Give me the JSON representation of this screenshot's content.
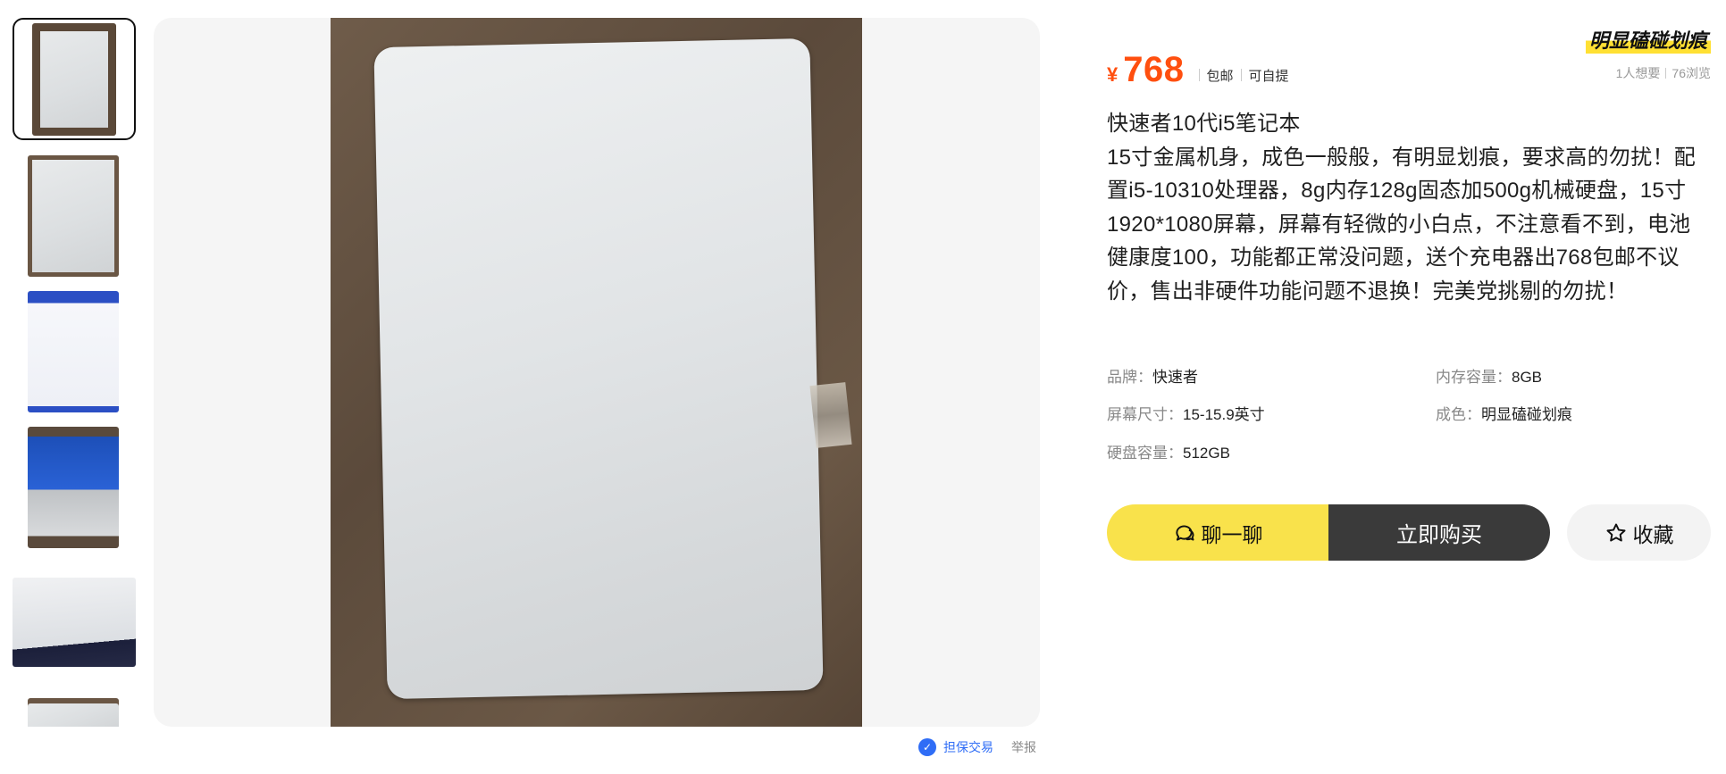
{
  "thumbnails": [
    {
      "name": "thumb-lid-top",
      "selected": true
    },
    {
      "name": "thumb-bottom"
    },
    {
      "name": "thumb-screen-specs"
    },
    {
      "name": "thumb-laptop-open"
    },
    {
      "name": "thumb-screen-closeup"
    },
    {
      "name": "thumb-partial"
    }
  ],
  "trust": {
    "guarantee_label": "担保交易",
    "report_label": "举报"
  },
  "listing": {
    "condition_tag": "明显磕碰划痕",
    "currency": "¥",
    "price": "768",
    "tag_shipping": "包邮",
    "tag_pickup": "可自提",
    "wants": "1人想要",
    "views": "76浏览",
    "description": "快速者10代i5笔记本\n15寸金属机身，成色一般般，有明显划痕，要求高的勿扰！配置i5-10310处理器，8g内存128g固态加500g机械硬盘，15寸1920*1080屏幕，屏幕有轻微的小白点，不注意看不到，电池健康度100，功能都正常没问题，送个充电器出768包邮不议价，售出非硬件功能问题不退换！完美党挑剔的勿扰！"
  },
  "attributes": [
    {
      "key": "品牌：",
      "value": "快速者"
    },
    {
      "key": "内存容量：",
      "value": "8GB"
    },
    {
      "key": "屏幕尺寸：",
      "value": "15-15.9英寸"
    },
    {
      "key": "成色：",
      "value": "明显磕碰划痕"
    },
    {
      "key": "硬盘容量：",
      "value": "512GB"
    }
  ],
  "actions": {
    "chat_label": "聊一聊",
    "buy_label": "立即购买",
    "favorite_label": "收藏"
  },
  "colors": {
    "price": "#ff4f0f",
    "chat_button": "#f9e24b",
    "buy_button": "#3a3a3a",
    "guarantee": "#2f6df6"
  },
  "icons": {
    "chat": "chat-bubble-icon",
    "favorite": "star-icon",
    "guarantee": "shield-icon"
  }
}
